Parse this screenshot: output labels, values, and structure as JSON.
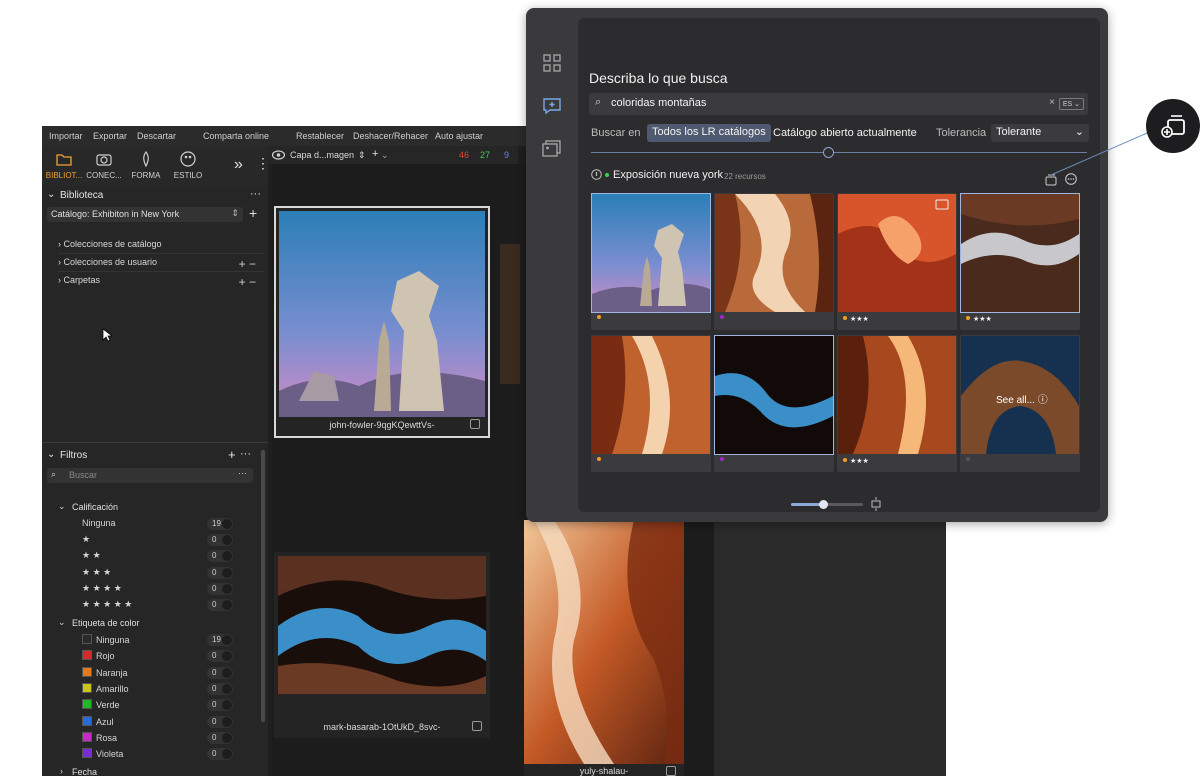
{
  "menu": {
    "items": [
      "Importar",
      "Exportar",
      "Descartar",
      "Comparta online",
      "Restablecer",
      "Deshacer/Rehacer",
      "Auto ajustar"
    ]
  },
  "modes": [
    {
      "label": "BIBLIOT...",
      "icon": "folder-icon",
      "active": true
    },
    {
      "label": "CONEC...",
      "icon": "camera-icon",
      "active": false
    },
    {
      "label": "FORMA",
      "icon": "brush-icon",
      "active": false
    },
    {
      "label": "ESTILO",
      "icon": "palette-icon",
      "active": false
    }
  ],
  "toolbar": {
    "layer_label": "Capa d...magen",
    "count_red": "46",
    "count_green": "27",
    "count_blue": "9"
  },
  "library": {
    "title": "Biblioteca",
    "catalog": "Catálogo: Exhibiton in New York",
    "items": [
      "Colecciones de catálogo",
      "Colecciones de usuario",
      "Carpetas"
    ]
  },
  "filters": {
    "title": "Filtros",
    "search_placeholder": "Buscar",
    "rating_title": "Calificación",
    "rating_rows": [
      {
        "label": "Ninguna",
        "count": "19"
      },
      {
        "label": "★",
        "count": "0"
      },
      {
        "label": "★ ★",
        "count": "0"
      },
      {
        "label": "★ ★ ★",
        "count": "0"
      },
      {
        "label": "★ ★ ★ ★",
        "count": "0"
      },
      {
        "label": "★ ★ ★ ★ ★",
        "count": "0"
      }
    ],
    "color_title": "Etiqueta de color",
    "color_rows": [
      {
        "label": "Ninguna",
        "count": "19",
        "color": "#2a2a2a"
      },
      {
        "label": "Rojo",
        "count": "0",
        "color": "#d42a2a"
      },
      {
        "label": "Naranja",
        "count": "0",
        "color": "#e07a1a"
      },
      {
        "label": "Amarillo",
        "count": "0",
        "color": "#c8c41a"
      },
      {
        "label": "Verde",
        "count": "0",
        "color": "#22b82a"
      },
      {
        "label": "Azul",
        "count": "0",
        "color": "#2a6ad6"
      },
      {
        "label": "Rosa",
        "count": "0",
        "color": "#c42ac4"
      },
      {
        "label": "Violeta",
        "count": "0",
        "color": "#7a2ad6"
      }
    ],
    "date_title": "Fecha"
  },
  "grid": {
    "captions": [
      "john-fowler-9qgKQewttVs-",
      "mark-basarab-1OtUkD_8svc-",
      "yuly-shalau-"
    ]
  },
  "ai_search": {
    "title": "Describa lo que busca",
    "query": "coloridas montañas",
    "lang": "ES",
    "scope_label": "Buscar en",
    "scope_options": [
      "Todos los LR catálogos",
      "Catálogo abierto actualmente"
    ],
    "scope_selected": "Todos los LR catálogos",
    "tolerance_label": "Tolerancia",
    "tolerance_value": "Tolerante",
    "result_group": "Exposición nueva york",
    "result_count": "22 recursos",
    "see_all": "See all...",
    "results": [
      {
        "meta": "",
        "dot": "#f0a020"
      },
      {
        "meta": "",
        "dot": "#9a2ad6"
      },
      {
        "meta": "★★★",
        "dot": "#f0a020"
      },
      {
        "meta": "★★★",
        "dot": "#f0a020"
      },
      {
        "meta": "",
        "dot": "#f0a020"
      },
      {
        "meta": "",
        "dot": "#9a2ad6"
      },
      {
        "meta": "★★★",
        "dot": "#f0a020"
      },
      {
        "meta": "",
        "dot": "#555555"
      }
    ],
    "zoom_level": 0.45
  },
  "colors": {
    "accent_blue": "#4f5a70",
    "active_mode": "#f0a030"
  }
}
